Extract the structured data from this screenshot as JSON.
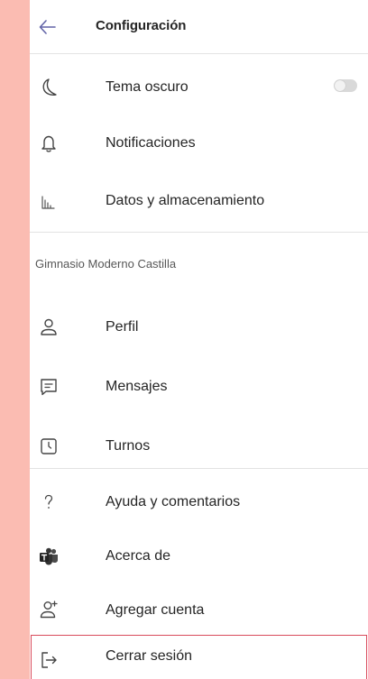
{
  "header": {
    "title": "Configuración",
    "back_icon": "arrow-left-icon"
  },
  "general": {
    "items": [
      {
        "label": "Tema oscuro",
        "icon": "moon-icon"
      },
      {
        "label": "Notificaciones",
        "icon": "bell-icon"
      },
      {
        "label": "Datos y almacenamiento",
        "icon": "bar-chart-icon"
      }
    ],
    "dark_theme_enabled": false
  },
  "organization": {
    "name": "Gimnasio Moderno Castilla",
    "items": [
      {
        "label": "Perfil",
        "icon": "person-icon"
      },
      {
        "label": "Mensajes",
        "icon": "message-icon"
      },
      {
        "label": "Turnos",
        "icon": "clock-icon"
      }
    ]
  },
  "help": {
    "items": [
      {
        "label": "Ayuda y comentarios",
        "icon": "question-icon"
      },
      {
        "label": "Acerca de",
        "icon": "teams-logo-icon"
      },
      {
        "label": "Agregar cuenta",
        "icon": "add-person-icon"
      }
    ]
  },
  "logout": {
    "label": "Cerrar sesión",
    "icon": "sign-out-icon"
  },
  "colors": {
    "background": "#fbbcb2",
    "highlight_border": "#d94b5c",
    "accent": "#6264a7"
  }
}
